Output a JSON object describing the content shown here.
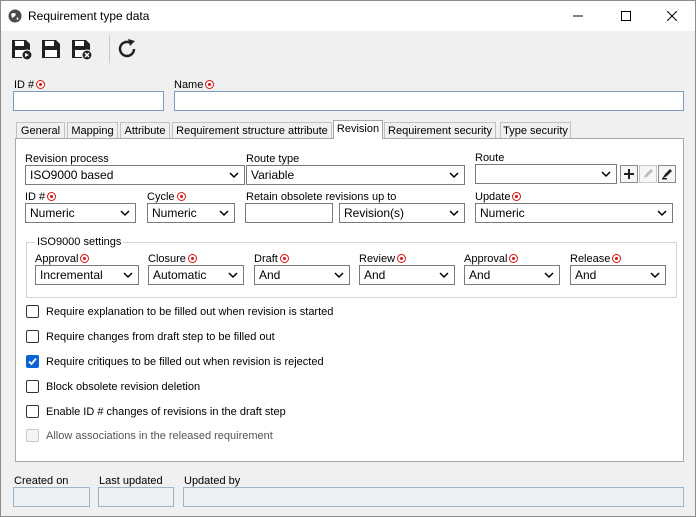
{
  "window": {
    "title": "Requirement type data"
  },
  "header": {
    "id_label": "ID #",
    "name_label": "Name",
    "id_value": "",
    "name_value": ""
  },
  "tabs": [
    {
      "label": "General"
    },
    {
      "label": "Mapping"
    },
    {
      "label": "Attribute"
    },
    {
      "label": "Requirement structure attribute"
    },
    {
      "label": "Revision"
    },
    {
      "label": "Requirement security"
    },
    {
      "label": "Type security"
    }
  ],
  "revision": {
    "revision_process": {
      "label": "Revision process",
      "value": "ISO9000 based"
    },
    "route_type": {
      "label": "Route type",
      "value": "Variable"
    },
    "route": {
      "label": "Route",
      "value": ""
    },
    "id": {
      "label": "ID #",
      "value": "Numeric"
    },
    "cycle": {
      "label": "Cycle",
      "value": "Numeric"
    },
    "retain": {
      "label": "Retain obsolete revisions up to",
      "value": "",
      "unit": "Revision(s)"
    },
    "update": {
      "label": "Update",
      "value": "Numeric"
    },
    "iso": {
      "title": "ISO9000 settings",
      "approval1": {
        "label": "Approval",
        "value": "Incremental"
      },
      "closure": {
        "label": "Closure",
        "value": "Automatic"
      },
      "draft": {
        "label": "Draft",
        "value": "And"
      },
      "review": {
        "label": "Review",
        "value": "And"
      },
      "approval2": {
        "label": "Approval",
        "value": "And"
      },
      "release": {
        "label": "Release",
        "value": "And"
      }
    },
    "checks": [
      {
        "label": "Require explanation to be filled out when revision is started",
        "checked": false
      },
      {
        "label": "Require changes from draft step to be filled out",
        "checked": false
      },
      {
        "label": "Require critiques to be filled out when revision is rejected",
        "checked": true
      },
      {
        "label": "Block obsolete revision deletion",
        "checked": false
      },
      {
        "label": "Enable ID # changes of revisions in the draft step",
        "checked": false
      },
      {
        "label": "Allow associations in the released requirement",
        "checked": false,
        "disabled": true
      }
    ]
  },
  "footer": {
    "created_on": "Created on",
    "last_updated": "Last updated",
    "updated_by": "Updated by"
  },
  "icons": {
    "save_new": "save-new-icon",
    "save": "save-icon",
    "save_close": "save-close-icon",
    "refresh": "refresh-icon"
  },
  "colors": {
    "accent": "#0a64d6",
    "required": "#dd1111",
    "field_border": "#7a9cc2"
  }
}
